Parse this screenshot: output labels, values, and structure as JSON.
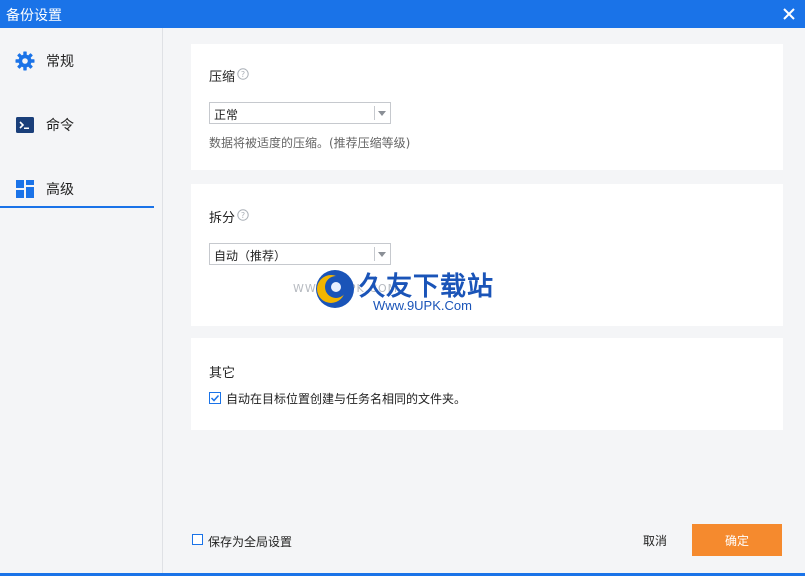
{
  "window": {
    "title": "备份设置"
  },
  "sidebar": {
    "items": [
      {
        "label": "常规",
        "icon": "gear-icon"
      },
      {
        "label": "命令",
        "icon": "terminal-icon"
      },
      {
        "label": "高级",
        "icon": "grid-icon",
        "active": true
      }
    ]
  },
  "compression": {
    "heading": "压缩",
    "selected": "正常",
    "hint": "数据将被适度的压缩。(推荐压缩等级)"
  },
  "split": {
    "heading": "拆分",
    "selected": "自动（推荐）"
  },
  "other": {
    "heading": "其它",
    "checkbox_label": "自动在目标位置创建与任务名相同的文件夹。",
    "checked": true
  },
  "watermark": {
    "faint": "WWW.9UPK.COM",
    "title": "久友下载站",
    "url": "Www.9UPK.Com"
  },
  "footer": {
    "save_global_label": "保存为全局设置",
    "cancel_label": "取消",
    "ok_label": "确定"
  },
  "colors": {
    "accent": "#1a73e8",
    "ok_button": "#f58a2e",
    "background": "#f4f5f7"
  }
}
